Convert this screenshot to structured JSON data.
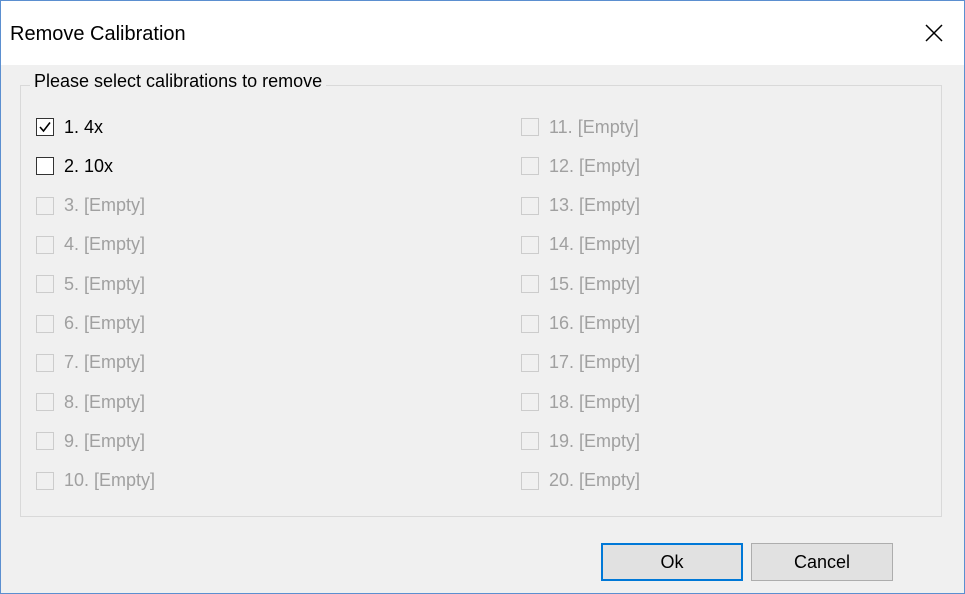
{
  "dialog": {
    "title": "Remove Calibration",
    "group_label": "Please select calibrations to remove"
  },
  "calibrations": [
    {
      "label": "1. 4x",
      "checked": true,
      "enabled": true
    },
    {
      "label": "2. 10x",
      "checked": false,
      "enabled": true
    },
    {
      "label": "3. [Empty]",
      "checked": false,
      "enabled": false
    },
    {
      "label": "4. [Empty]",
      "checked": false,
      "enabled": false
    },
    {
      "label": "5. [Empty]",
      "checked": false,
      "enabled": false
    },
    {
      "label": "6. [Empty]",
      "checked": false,
      "enabled": false
    },
    {
      "label": "7. [Empty]",
      "checked": false,
      "enabled": false
    },
    {
      "label": "8. [Empty]",
      "checked": false,
      "enabled": false
    },
    {
      "label": "9. [Empty]",
      "checked": false,
      "enabled": false
    },
    {
      "label": "10. [Empty]",
      "checked": false,
      "enabled": false
    },
    {
      "label": "11. [Empty]",
      "checked": false,
      "enabled": false
    },
    {
      "label": "12. [Empty]",
      "checked": false,
      "enabled": false
    },
    {
      "label": "13. [Empty]",
      "checked": false,
      "enabled": false
    },
    {
      "label": "14. [Empty]",
      "checked": false,
      "enabled": false
    },
    {
      "label": "15. [Empty]",
      "checked": false,
      "enabled": false
    },
    {
      "label": "16. [Empty]",
      "checked": false,
      "enabled": false
    },
    {
      "label": "17. [Empty]",
      "checked": false,
      "enabled": false
    },
    {
      "label": "18. [Empty]",
      "checked": false,
      "enabled": false
    },
    {
      "label": "19. [Empty]",
      "checked": false,
      "enabled": false
    },
    {
      "label": "20. [Empty]",
      "checked": false,
      "enabled": false
    }
  ],
  "buttons": {
    "ok_label": "Ok",
    "cancel_label": "Cancel"
  },
  "colors": {
    "accent": "#0078d7",
    "window_border": "#5b8fd0",
    "disabled_text": "#a0a0a0"
  }
}
